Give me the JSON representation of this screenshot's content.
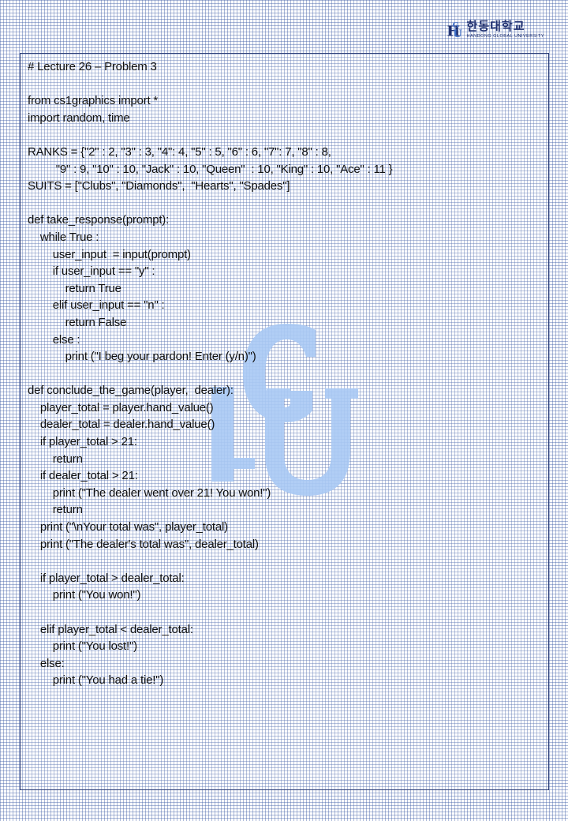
{
  "logo": {
    "korean_name": "한동대학교",
    "english_name": "HANDONG GLOBAL UNIVERSITY",
    "brand_color": "#1f2f6e",
    "icon": "hgu-logo-icon"
  },
  "watermark": {
    "icon": "hgu-watermark-icon",
    "color": "#a9c9f5"
  },
  "colors": {
    "grid": "#4664aa",
    "frame_border": "#2a3b75",
    "text": "#111111"
  },
  "code_lines": [
    "# Lecture 26 – Problem 3",
    "",
    "from cs1graphics import *",
    "import random, time",
    "",
    "RANKS = {\"2\" : 2, \"3\" : 3, \"4\": 4, \"5\" : 5, \"6\" : 6, \"7\": 7, \"8\" : 8,",
    "         \"9\" : 9, \"10\" : 10, \"Jack\" : 10, \"Queen\"  : 10, \"King\" : 10, \"Ace\" : 11 }",
    "SUITS = [\"Clubs\", \"Diamonds\",  \"Hearts\", \"Spades\"]",
    "",
    "def take_response(prompt):",
    "    while True :",
    "        user_input  = input(prompt)",
    "        if user_input == \"y\" :",
    "            return True",
    "        elif user_input == \"n\" :",
    "            return False",
    "        else :",
    "            print (\"I beg your pardon! Enter (y/n)\")",
    "",
    "def conclude_the_game(player,  dealer):",
    "    player_total = player.hand_value()",
    "    dealer_total = dealer.hand_value()",
    "    if player_total > 21:",
    "        return",
    "    if dealer_total > 21:",
    "        print (\"The dealer went over 21! You won!\")",
    "        return",
    "    print (\"\\nYour total was\", player_total)",
    "    print (\"The dealer's total was\", dealer_total)",
    "",
    "    if player_total > dealer_total:",
    "        print (\"You won!\")",
    "",
    "    elif player_total < dealer_total:",
    "        print (\"You lost!\")",
    "    else:",
    "        print (\"You had a tie!\")"
  ]
}
